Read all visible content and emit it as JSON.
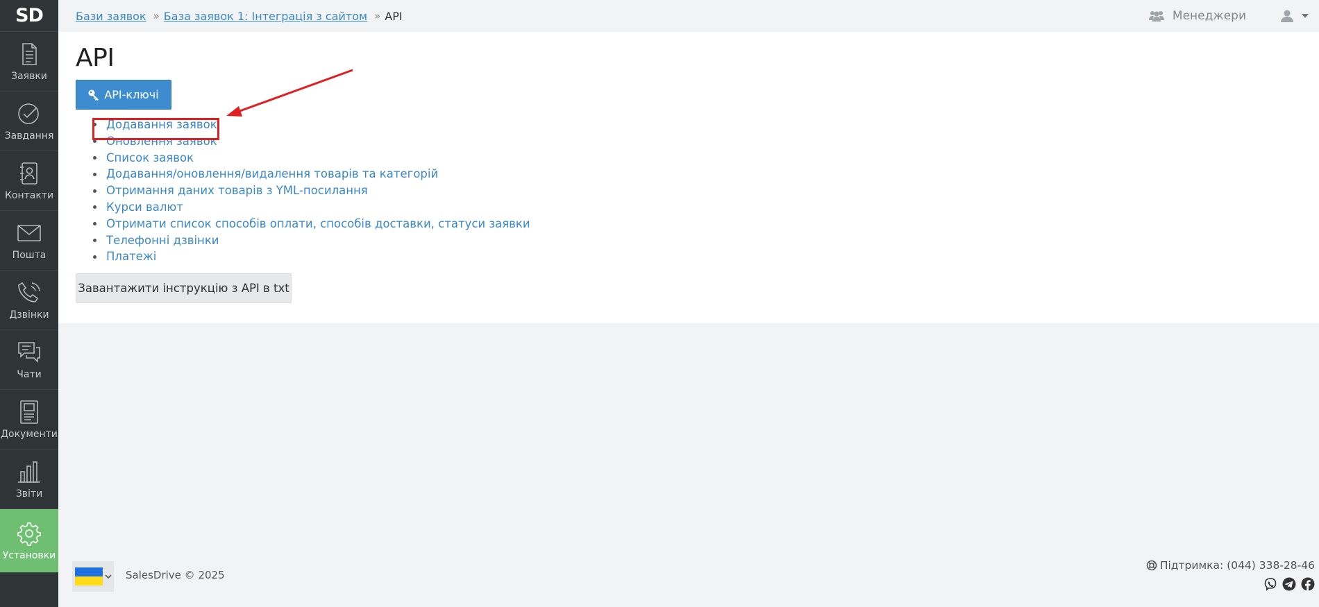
{
  "sidebar": {
    "logo": "SD",
    "items": [
      {
        "label": "Заявки",
        "icon": "document-icon"
      },
      {
        "label": "Завдання",
        "icon": "check-circle-icon"
      },
      {
        "label": "Контакти",
        "icon": "contacts-icon"
      },
      {
        "label": "Пошта",
        "icon": "mail-icon"
      },
      {
        "label": "Дзвінки",
        "icon": "phone-icon"
      },
      {
        "label": "Чати",
        "icon": "chat-icon"
      },
      {
        "label": "Документи",
        "icon": "documents-icon"
      },
      {
        "label": "Звіти",
        "icon": "bar-chart-icon"
      },
      {
        "label": "Установки",
        "icon": "gear-icon",
        "active": true
      }
    ]
  },
  "breadcrumb": {
    "items": [
      "Бази заявок",
      "База заявок 1: Інтеграція з сайтом"
    ],
    "separator": "»",
    "current": "API"
  },
  "header": {
    "managers_label": "Менеджери"
  },
  "page": {
    "title": "API",
    "api_keys_button": "API-ключі",
    "links": [
      "Додавання заявок",
      "Оновлення заявок",
      "Список заявок",
      "Додавання/оновлення/видалення товарів та категорій",
      "Отримання даних товарів з YML-посилання",
      "Курси валют",
      "Отримати список способів оплати, способів доставки, статуси заявки",
      "Телефонні дзвінки",
      "Платежі"
    ],
    "download_button": "Завантажити інструкцію з API в txt"
  },
  "footer": {
    "copyright": "SalesDrive © 2025",
    "support": "Підтримка: (044) 338-28-46",
    "language_flag": "ukraine-flag-icon"
  },
  "colors": {
    "sidebar_bg": "#2f3437",
    "active_item": "#6fbf73",
    "link": "#3a88c4",
    "primary_button": "#3d8ccf",
    "annotation": "#e02020"
  }
}
